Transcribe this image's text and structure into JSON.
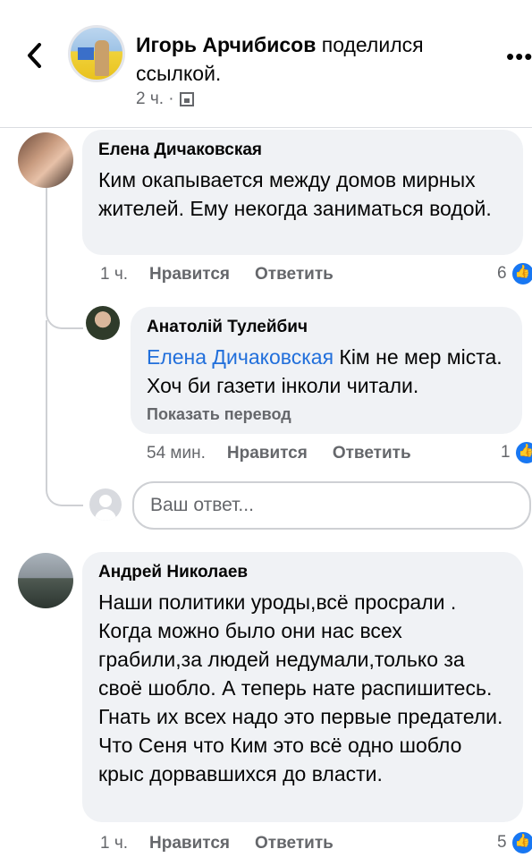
{
  "header": {
    "author": "Игорь Арчибисов",
    "action": "поделился ссылкой.",
    "time": "2 ч. ·",
    "more": "•••"
  },
  "comments": [
    {
      "author": "Елена Дичаковская",
      "text": "Ким окапывается между домов мирных жителей. Ему некогда заниматься водой.",
      "time": "1 ч.",
      "like": "Нравится",
      "reply": "Ответить",
      "reactions": "6"
    },
    {
      "author": "Анатолій Тулейбич",
      "mention": "Елена Дичаковская",
      "text": " Кім не мер міста. Хоч би газети інколи читали.",
      "translate": "Показать перевод",
      "time": "54 мин.",
      "like": "Нравится",
      "reply": "Ответить",
      "reactions": "1"
    },
    {
      "author": "Андрей Николаев",
      "text": "Наши политики уроды,всё просрали . Когда можно было они нас всех грабили,за людей недумали,только за своё шобло. А теперь нате распишитесь. Гнать их всех надо это первые предатели. Что Сеня что Ким это всё одно шобло крыс дорвавшихся до власти.",
      "time": "1 ч.",
      "like": "Нравится",
      "reply": "Ответить",
      "reactions": "5"
    }
  ],
  "reply_box": {
    "placeholder": "Ваш ответ..."
  }
}
